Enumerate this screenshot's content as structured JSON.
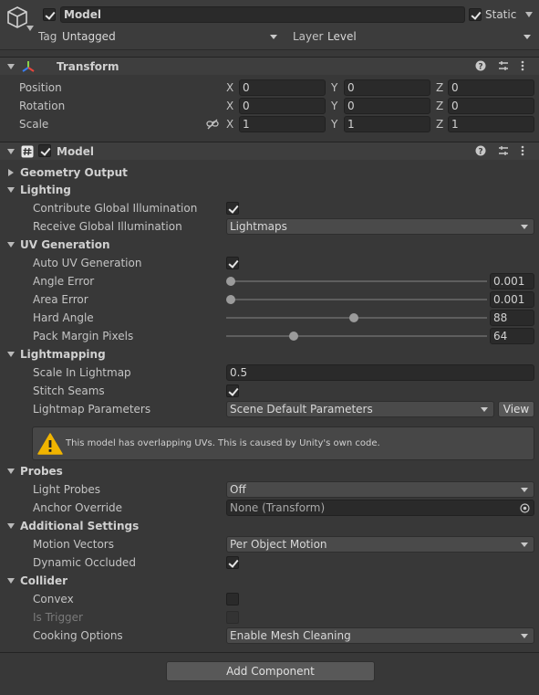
{
  "header": {
    "object_name": "Model",
    "active": true,
    "static_checked": true,
    "static_label": "Static",
    "tag_label": "Tag",
    "tag_value": "Untagged",
    "layer_label": "Layer",
    "layer_value": "Level"
  },
  "transform": {
    "title": "Transform",
    "rows": [
      {
        "label": "Position",
        "x": "0",
        "y": "0",
        "z": "0"
      },
      {
        "label": "Rotation",
        "x": "0",
        "y": "0",
        "z": "0"
      },
      {
        "label": "Scale",
        "x": "1",
        "y": "1",
        "z": "1"
      }
    ],
    "axis": {
      "x": "X",
      "y": "Y",
      "z": "Z"
    }
  },
  "model": {
    "title": "Model",
    "enabled": true,
    "geometry_output": "Geometry Output",
    "lighting": {
      "title": "Lighting",
      "contribute_gi_label": "Contribute Global Illumination",
      "contribute_gi": true,
      "receive_gi_label": "Receive Global Illumination",
      "receive_gi_value": "Lightmaps"
    },
    "uv": {
      "title": "UV Generation",
      "auto_uv_label": "Auto UV Generation",
      "auto_uv": true,
      "angle_error_label": "Angle Error",
      "angle_error": "0.001",
      "angle_error_fraction": 0.0,
      "area_error_label": "Area Error",
      "area_error": "0.001",
      "area_error_fraction": 0.0,
      "hard_angle_label": "Hard Angle",
      "hard_angle": "88",
      "hard_angle_fraction": 0.49,
      "pack_margin_label": "Pack Margin Pixels",
      "pack_margin": "64",
      "pack_margin_fraction": 0.25
    },
    "lightmapping": {
      "title": "Lightmapping",
      "scale_label": "Scale In Lightmap",
      "scale_value": "0.5",
      "stitch_label": "Stitch Seams",
      "stitch": true,
      "params_label": "Lightmap Parameters",
      "params_value": "Scene Default Parameters",
      "view_button": "View",
      "warning": "This model has overlapping UVs. This is caused by Unity's own code."
    },
    "probes": {
      "title": "Probes",
      "light_probes_label": "Light Probes",
      "light_probes_value": "Off",
      "anchor_label": "Anchor Override",
      "anchor_value": "None (Transform)"
    },
    "additional": {
      "title": "Additional Settings",
      "motion_label": "Motion Vectors",
      "motion_value": "Per Object Motion",
      "dynamic_occluded_label": "Dynamic Occluded",
      "dynamic_occluded": true
    },
    "collider": {
      "title": "Collider",
      "convex_label": "Convex",
      "convex": false,
      "is_trigger_label": "Is Trigger",
      "is_trigger": false,
      "cooking_label": "Cooking Options",
      "cooking_value": "Enable Mesh Cleaning"
    }
  },
  "add_component_button": "Add Component",
  "colors": {
    "background": "#383838",
    "field": "#2a2a2a",
    "warning_yellow": "#f0b400"
  }
}
